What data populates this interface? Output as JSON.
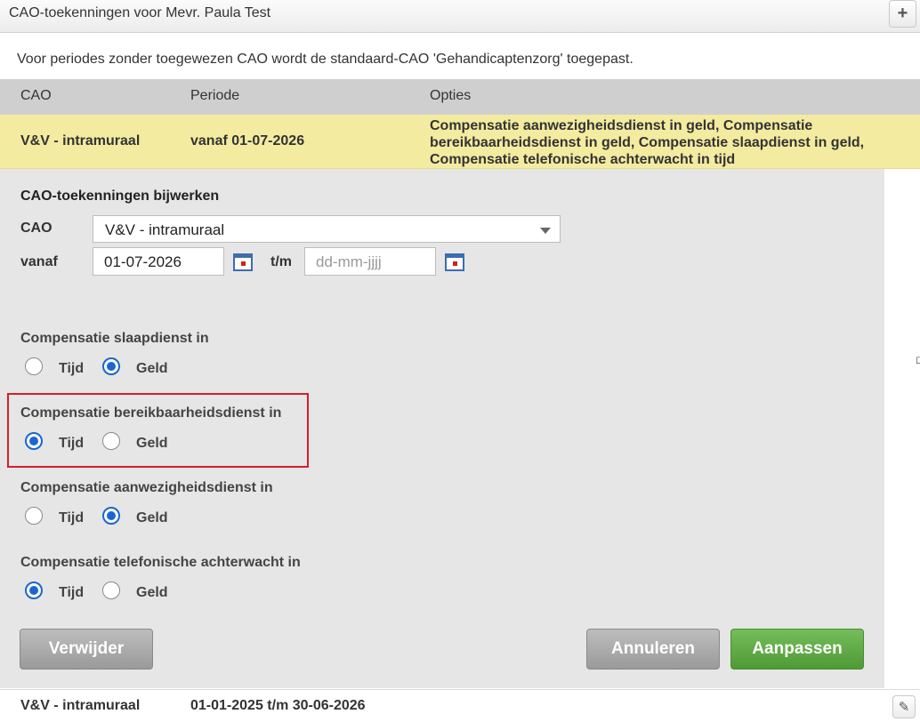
{
  "header": {
    "title": "CAO-toekenningen voor Mevr. Paula Test",
    "add_label": "+"
  },
  "notice": "Voor periodes zonder toegewezen CAO wordt de standaard-CAO 'Gehandicaptenzorg' toegepast.",
  "table": {
    "columns": [
      "CAO",
      "Periode",
      "Opties"
    ],
    "active_row": {
      "cao": "V&V - intramuraal",
      "periode": "vanaf 01-07-2026",
      "opties": "Compensatie aanwezigheidsdienst in geld, Compensatie bereikbaarheidsdienst in geld, Compensatie slaapdienst in geld, Compensatie telefonische achterwacht in tijd"
    },
    "other_row": {
      "cao": "V&V - intramuraal",
      "periode": "01-01-2025 t/m 30-06-2026"
    }
  },
  "form": {
    "title": "CAO-toekenningen bijwerken",
    "cao_label": "CAO",
    "cao_value": "V&V - intramuraal",
    "vanaf_label": "vanaf",
    "vanaf_value": "01-07-2026",
    "tm_label": "t/m",
    "tm_placeholder": "dd-mm-jjjj",
    "groups": [
      {
        "label": "Compensatie slaapdienst in",
        "options": [
          "Tijd",
          "Geld"
        ],
        "selected": "Geld"
      },
      {
        "label": "Compensatie bereikbaarheidsdienst in",
        "options": [
          "Tijd",
          "Geld"
        ],
        "selected": "Tijd"
      },
      {
        "label": "Compensatie aanwezigheidsdienst in",
        "options": [
          "Tijd",
          "Geld"
        ],
        "selected": "Geld"
      },
      {
        "label": "Compensatie telefonische achterwacht in",
        "options": [
          "Tijd",
          "Geld"
        ],
        "selected": "Tijd"
      }
    ],
    "buttons": {
      "delete": "Verwijder",
      "cancel": "Annuleren",
      "save": "Aanpassen"
    }
  },
  "colors": {
    "active_row": "#f3eba0",
    "highlight_border": "#d1202a",
    "radio_selected": "#1a66d0",
    "save_button": "#5aa83f"
  }
}
